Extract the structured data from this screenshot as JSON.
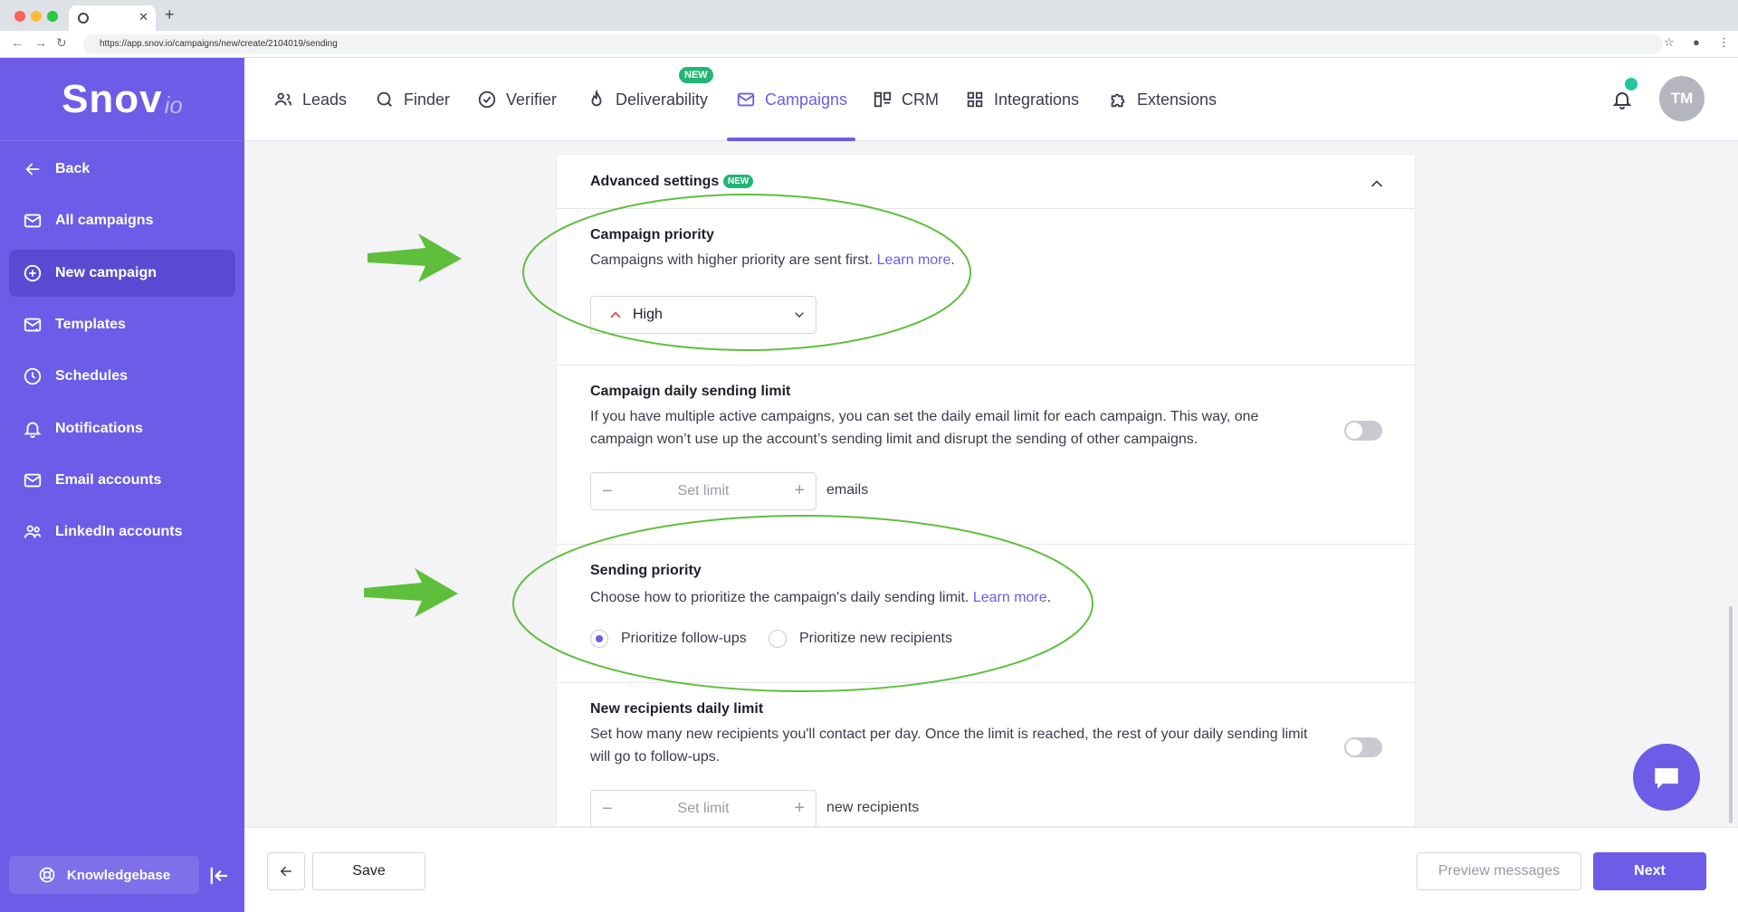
{
  "browser": {
    "url": "https://app.snov.io/campaigns/new/create/2104019/sending"
  },
  "logo": {
    "main": "Snov",
    "sub": "io"
  },
  "sidebar": {
    "items": [
      {
        "label": "Back",
        "icon": "arrow-left-icon"
      },
      {
        "label": "All campaigns",
        "icon": "mail-icon"
      },
      {
        "label": "New campaign",
        "icon": "plus-circle-icon",
        "active": true
      },
      {
        "label": "Templates",
        "icon": "template-icon"
      },
      {
        "label": "Schedules",
        "icon": "clock-icon"
      },
      {
        "label": "Notifications",
        "icon": "bell-icon"
      },
      {
        "label": "Email accounts",
        "icon": "mail-icon"
      },
      {
        "label": "LinkedIn accounts",
        "icon": "users-icon"
      }
    ],
    "knowledgebase": "Knowledgebase"
  },
  "nav": {
    "items": [
      {
        "label": "Leads",
        "icon": "users-icon"
      },
      {
        "label": "Finder",
        "icon": "search-icon"
      },
      {
        "label": "Verifier",
        "icon": "check-circle-icon"
      },
      {
        "label": "Deliverability",
        "icon": "flame-icon"
      },
      {
        "label": "Campaigns",
        "icon": "mail-icon",
        "active": true
      },
      {
        "label": "CRM",
        "icon": "crm-icon"
      },
      {
        "label": "Integrations",
        "icon": "grid-icon"
      },
      {
        "label": "Extensions",
        "icon": "puzzle-icon"
      }
    ],
    "new_badge": "NEW",
    "avatar_initials": "TM"
  },
  "advanced": {
    "title": "Advanced settings",
    "badge": "NEW",
    "campaign_priority": {
      "title": "Campaign priority",
      "desc": "Campaigns with higher priority are sent first. ",
      "link": "Learn more",
      "link_suffix": ".",
      "selected": "High"
    },
    "daily_limit": {
      "title": "Campaign daily sending limit",
      "desc_line1": "If you have multiple active campaigns, you can set the daily email limit for each campaign. This way, one",
      "desc_line2": "campaign won’t use up the account’s sending limit and disrupt the sending of other campaigns.",
      "placeholder": "Set limit",
      "unit": "emails",
      "enabled": false
    },
    "sending_priority": {
      "title": "Sending priority",
      "desc": "Choose how to prioritize the campaign's daily sending limit. ",
      "link": "Learn more",
      "link_suffix": ".",
      "options": [
        "Prioritize follow-ups",
        "Prioritize new recipients"
      ],
      "selected_index": 0
    },
    "new_recipients": {
      "title": "New recipients daily limit",
      "desc_line1": "Set how many new recipients you'll contact per day. Once the limit is reached, the rest of your daily sending limit",
      "desc_line2": "will go to follow-ups.",
      "placeholder": "Set limit",
      "unit": "new recipients",
      "enabled": false
    }
  },
  "bottom": {
    "save": "Save",
    "preview": "Preview messages",
    "next": "Next"
  },
  "colors": {
    "brand": "#6c5ce7",
    "badge_green": "#22b573",
    "annotation_green": "#5fbf3c",
    "priority_up": "#e5484d"
  }
}
